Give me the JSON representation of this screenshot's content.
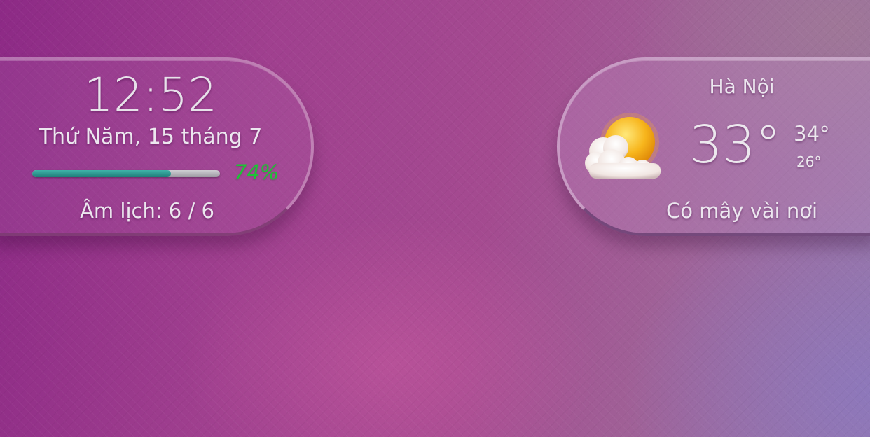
{
  "clock_widget": {
    "time": "12:52",
    "date": "Thứ Năm, 15 tháng 7",
    "battery_level_fraction": 0.74,
    "battery_percent": "74%",
    "lunar_date": "Âm lịch: 6 / 6"
  },
  "weather_widget": {
    "city": "Hà Nội",
    "icon": "partly-cloudy-sun-icon",
    "temperature_now": "33°",
    "temperature_high": "34°",
    "temperature_low": "26°",
    "condition": "Có mây vài nơi"
  },
  "colors": {
    "battery_fill": "#2a9a92",
    "battery_percent_text": "#1ec436"
  }
}
